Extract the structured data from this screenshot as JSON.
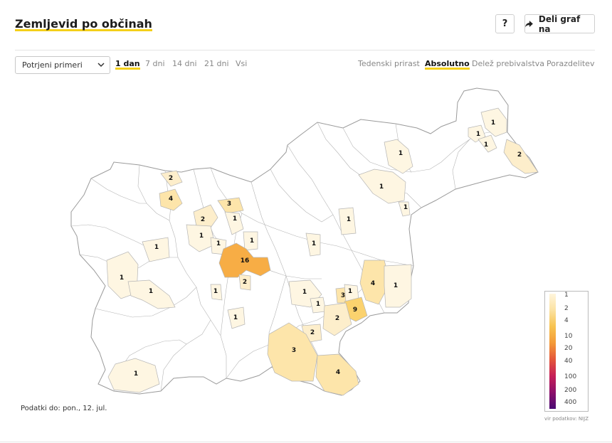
{
  "header": {
    "title": "Zemljevid po občinah",
    "help_label": "?",
    "share_label": "Deli graf na"
  },
  "controls": {
    "metric_select": "Potrjeni primeri",
    "period_tabs": [
      "1 dan",
      "7 dni",
      "14 dni",
      "21 dni",
      "Vsi"
    ],
    "period_active": "1 dan",
    "mode_tabs": [
      "Tedenski prirast",
      "Absolutno",
      "Delež prebivalstva",
      "Porazdelitev"
    ],
    "mode_active": "Absolutno"
  },
  "footnote": "Podatki do: pon., 12. jul.",
  "source": "vir podatkov: NIJZ",
  "legend": {
    "ticks": [
      "1",
      "2",
      "4",
      "10",
      "20",
      "40",
      "100",
      "200",
      "400"
    ],
    "colors": [
      "#fff5dc",
      "#fbe2a2",
      "#f7c34f",
      "#f49a38",
      "#e4563a",
      "#c61f57",
      "#8c0f6a",
      "#4a0a73"
    ]
  },
  "map": {
    "municipality_values": [
      {
        "value": 1
      },
      {
        "value": 1
      },
      {
        "value": 1
      },
      {
        "value": 2
      },
      {
        "value": 1
      },
      {
        "value": 1
      },
      {
        "value": 1
      },
      {
        "value": 2
      },
      {
        "value": 4
      },
      {
        "value": 3
      },
      {
        "value": 2
      },
      {
        "value": 1
      },
      {
        "value": 1
      },
      {
        "value": 1
      },
      {
        "value": 1
      },
      {
        "value": 1
      },
      {
        "value": 1
      },
      {
        "value": 16
      },
      {
        "value": 1
      },
      {
        "value": 1
      },
      {
        "value": 1
      },
      {
        "value": 2
      },
      {
        "value": 1
      },
      {
        "value": 4
      },
      {
        "value": 1
      },
      {
        "value": 1
      },
      {
        "value": 1
      },
      {
        "value": 3
      },
      {
        "value": 1
      },
      {
        "value": 9
      },
      {
        "value": 2
      },
      {
        "value": 2
      },
      {
        "value": 3
      },
      {
        "value": 4
      },
      {
        "value": 1
      },
      {
        "value": 1
      }
    ]
  }
}
